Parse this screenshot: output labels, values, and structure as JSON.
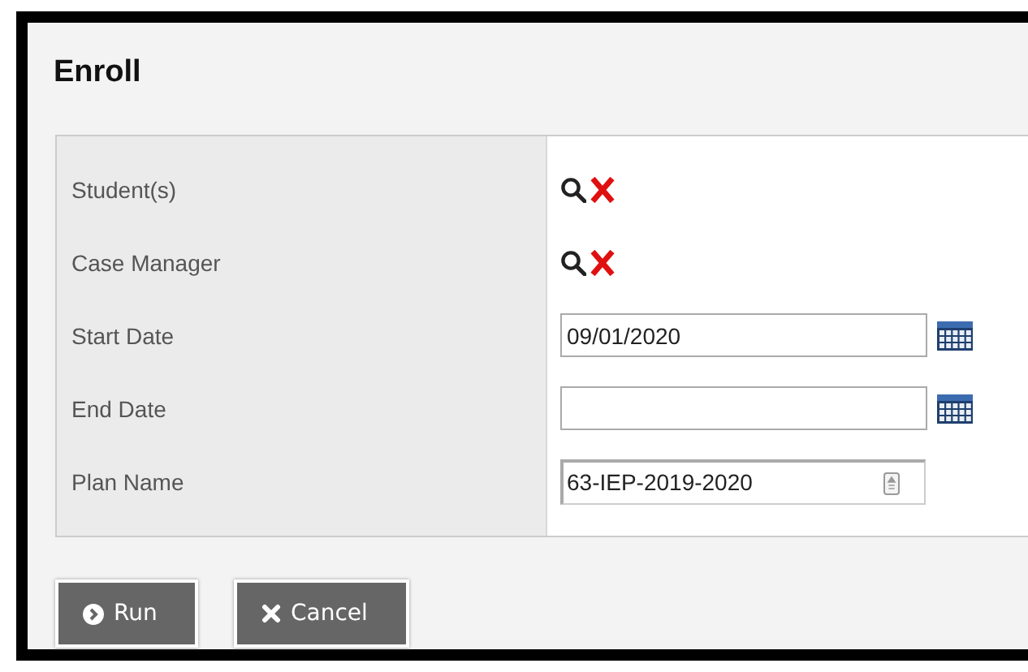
{
  "dialog": {
    "title": "Enroll"
  },
  "fields": [
    {
      "label": "Student(s)",
      "kind": "lookup"
    },
    {
      "label": "Case Manager",
      "kind": "lookup"
    },
    {
      "label": "Start Date",
      "kind": "date",
      "value": "09/01/2020"
    },
    {
      "label": "End Date",
      "kind": "date"
    },
    {
      "label": "Plan Name",
      "kind": "picklist",
      "value": "63-IEP-2019-2020"
    }
  ],
  "buttons": [
    {
      "label": "Run",
      "kind": "run"
    },
    {
      "label": "Cancel",
      "kind": "cancel"
    }
  ]
}
